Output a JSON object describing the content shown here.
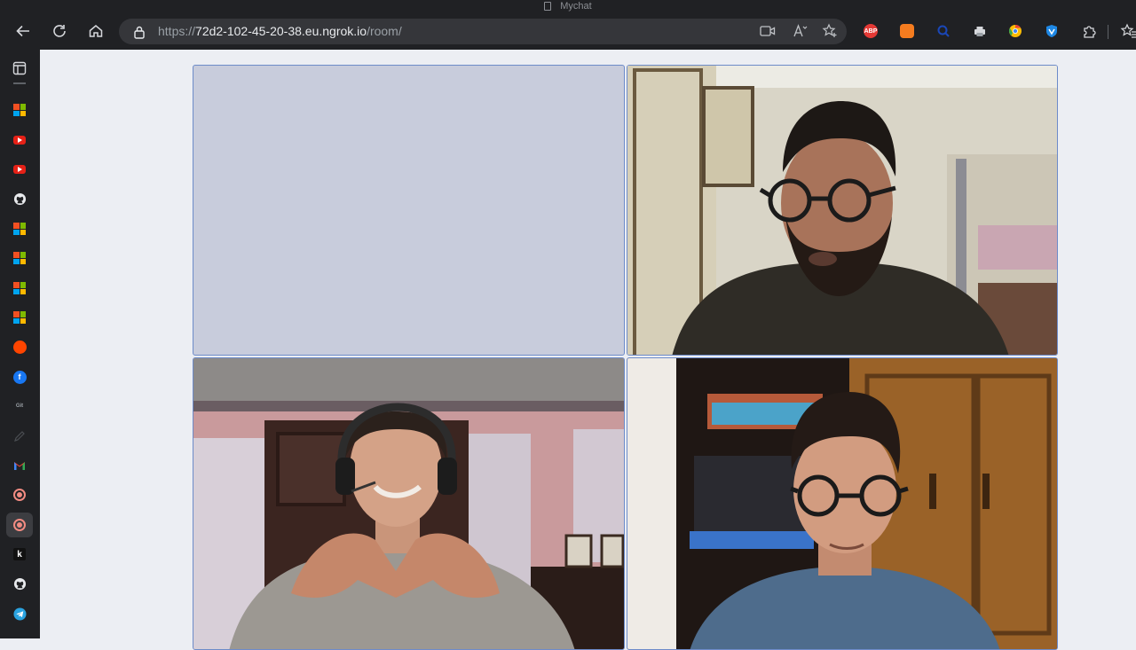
{
  "window": {
    "title": "Mychat"
  },
  "address_bar": {
    "url_prefix": "https://",
    "url_host": "72d2-102-45-20-38.eu.ngrok.io",
    "url_path": "/room/"
  },
  "extensions": [
    {
      "name": "adblock-plus-icon",
      "label": "ABP",
      "color": "#e53935"
    },
    {
      "name": "extension-orange-icon",
      "label": "",
      "color": "#f57c1f"
    },
    {
      "name": "extension-blue-icon",
      "label": "",
      "color": "#1a47b8"
    },
    {
      "name": "printer-icon",
      "label": "",
      "color": "#d6d8dc"
    },
    {
      "name": "chrome-icon",
      "label": "",
      "color": "#fbbc04"
    },
    {
      "name": "vpn-shield-icon",
      "label": "",
      "color": "#1e88e5"
    }
  ],
  "sidebar_tabs": [
    {
      "name": "sidebar-tab-microsoft-1",
      "icon": "microsoft-icon"
    },
    {
      "name": "sidebar-tab-youtube-1",
      "icon": "youtube-icon"
    },
    {
      "name": "sidebar-tab-youtube-2",
      "icon": "youtube-icon"
    },
    {
      "name": "sidebar-tab-github-1",
      "icon": "github-icon"
    },
    {
      "name": "sidebar-tab-microsoft-2",
      "icon": "microsoft-icon"
    },
    {
      "name": "sidebar-tab-microsoft-3",
      "icon": "microsoft-icon"
    },
    {
      "name": "sidebar-tab-microsoft-4",
      "icon": "microsoft-icon"
    },
    {
      "name": "sidebar-tab-microsoft-5",
      "icon": "microsoft-icon"
    },
    {
      "name": "sidebar-tab-reddit",
      "icon": "reddit-icon"
    },
    {
      "name": "sidebar-tab-facebook",
      "icon": "facebook-icon"
    },
    {
      "name": "sidebar-tab-git",
      "icon": "git-icon"
    },
    {
      "name": "sidebar-tab-pencil",
      "icon": "pencil-icon"
    },
    {
      "name": "sidebar-tab-gmail",
      "icon": "gmail-icon"
    },
    {
      "name": "sidebar-tab-record-1",
      "icon": "record-icon"
    },
    {
      "name": "sidebar-tab-record-2",
      "icon": "record-icon",
      "active": true
    },
    {
      "name": "sidebar-tab-k",
      "icon": "k-icon"
    },
    {
      "name": "sidebar-tab-github-2",
      "icon": "github-icon"
    },
    {
      "name": "sidebar-tab-telegram",
      "icon": "telegram-icon"
    }
  ],
  "colors": {
    "page_background": "#eceef3",
    "browser_chrome": "#202124",
    "empty_tile": "#c8ccdc",
    "tile_border": "#6d8bc9"
  },
  "video_tiles": [
    {
      "name": "video-tile-empty",
      "state": "no video"
    },
    {
      "name": "video-tile-participant-1",
      "state": "video"
    },
    {
      "name": "video-tile-participant-2",
      "state": "video"
    },
    {
      "name": "video-tile-participant-3",
      "state": "video"
    }
  ]
}
